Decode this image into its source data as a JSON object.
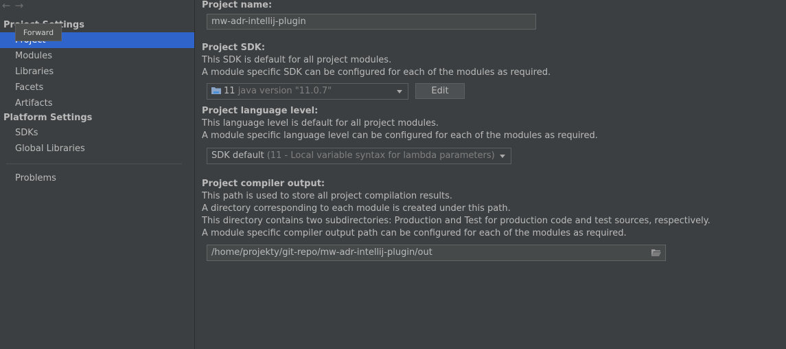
{
  "sidebar": {
    "project_settings_header": "Project Settings",
    "items_project": [
      {
        "label": "Project"
      },
      {
        "label": "Modules"
      },
      {
        "label": "Libraries"
      },
      {
        "label": "Facets"
      },
      {
        "label": "Artifacts"
      }
    ],
    "platform_settings_header": "Platform Settings",
    "items_platform": [
      {
        "label": "SDKs"
      },
      {
        "label": "Global Libraries"
      }
    ],
    "problems_label": "Problems",
    "tooltip": "Forward"
  },
  "main": {
    "project_name": {
      "label": "Project name:",
      "value": "mw-adr-intellij-plugin"
    },
    "project_sdk": {
      "label": "Project SDK:",
      "line1": "This SDK is default for all project modules.",
      "line2": "A module specific SDK can be configured for each of the modules as required.",
      "selected_name": "11",
      "selected_detail": "java version \"11.0.7\"",
      "edit_label": "Edit"
    },
    "language_level": {
      "label": "Project language level:",
      "line1": "This language level is default for all project modules.",
      "line2": "A module specific language level can be configured for each of the modules as required.",
      "selected_name": "SDK default",
      "selected_detail": "(11 - Local variable syntax for lambda parameters)"
    },
    "compiler_output": {
      "label": "Project compiler output:",
      "line1": "This path is used to store all project compilation results.",
      "line2": "A directory corresponding to each module is created under this path.",
      "line3": "This directory contains two subdirectories: Production and Test for production code and test sources, respectively.",
      "line4": "A module specific compiler output path can be configured for each of the modules as required.",
      "path": "/home/projekty/git-repo/mw-adr-intellij-plugin/out"
    }
  },
  "colors": {
    "background": "#3c3f41",
    "selection": "#2f65ca",
    "text": "#bbbbbb"
  }
}
